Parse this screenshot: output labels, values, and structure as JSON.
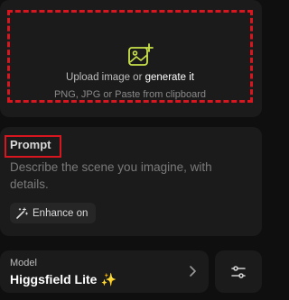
{
  "upload": {
    "prefix": "Upload image or ",
    "generate_link": "generate it",
    "hint": "PNG, JPG or Paste from clipboard",
    "icon": "image-plus-icon",
    "accent_color": "#c9e24a"
  },
  "prompt": {
    "title": "Prompt",
    "placeholder": "Describe the scene you imagine, with details.",
    "enhance_label": "Enhance on",
    "enhance_icon": "magic-wand-icon"
  },
  "model": {
    "label": "Model",
    "name": "Higgsfield Lite",
    "sparkle": "✨",
    "chevron_icon": "chevron-right-icon",
    "settings_icon": "sliders-icon"
  },
  "colors": {
    "highlight": "#d8161f",
    "card": "#1b1b1c",
    "background": "#0f0f10"
  }
}
